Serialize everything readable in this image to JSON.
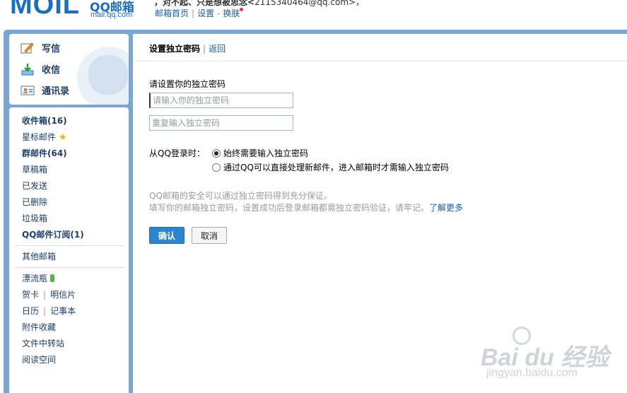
{
  "header": {
    "logo_mark": "MOIL",
    "logo_text": "QQ邮箱",
    "logo_sub": "mail.qq.com",
    "greeting_prefix": "，对不起、只是想被思念<",
    "greeting_email": "2115340464@qq.com",
    "greeting_suffix": ">，",
    "links": [
      "邮箱首页",
      "设置",
      "换肤"
    ]
  },
  "sidebar": {
    "actions": [
      {
        "label": "写信",
        "icon": "compose-icon"
      },
      {
        "label": "收信",
        "icon": "inbox-download-icon"
      },
      {
        "label": "通讯录",
        "icon": "contacts-card-icon"
      }
    ],
    "folders": [
      {
        "label": "收件箱(16)",
        "bold": true
      },
      {
        "label": "星标邮件",
        "bold": false
      },
      {
        "label": "群邮件(64)",
        "bold": true
      },
      {
        "label": "草稿箱",
        "bold": false
      },
      {
        "label": "已发送",
        "bold": false
      },
      {
        "label": "已删除",
        "bold": false
      },
      {
        "label": "垃圾箱",
        "bold": false
      },
      {
        "label": "QQ邮件订阅(1)",
        "bold": true
      }
    ],
    "other_mailbox": "其他邮箱",
    "drift_bottle": "漂流瓶",
    "greeting_card": "贺卡",
    "postcard": "明信片",
    "calendar": "日历",
    "notebook": "记事本",
    "attachments": "附件收藏",
    "file_transfer": "文件中转站",
    "reading_space": "阅读空间"
  },
  "main": {
    "title": "设置独立密码",
    "back": "返回",
    "prompt": "请设置你的独立密码",
    "password_placeholder": "请输入你的独立密码",
    "confirm_placeholder": "重复输入独立密码",
    "login_option_label": "从QQ登录时：",
    "options": [
      "始终需要输入独立密码",
      "通过QQ可以直接处理新邮件，进入邮箱时才需输入独立密码"
    ],
    "selected_option": 0,
    "tip_line1": "QQ邮箱的安全可以通过独立密码得到充分保证。",
    "tip_line2": "填写你的邮箱独立密码，设置成功后登录邮箱都需独立密码验证，请牢记。",
    "learn_more": "了解更多",
    "ok_button": "确认",
    "cancel_button": "取消"
  },
  "watermark": {
    "brand": "Bai du 经验",
    "url": "jingyan.baidu.com"
  }
}
